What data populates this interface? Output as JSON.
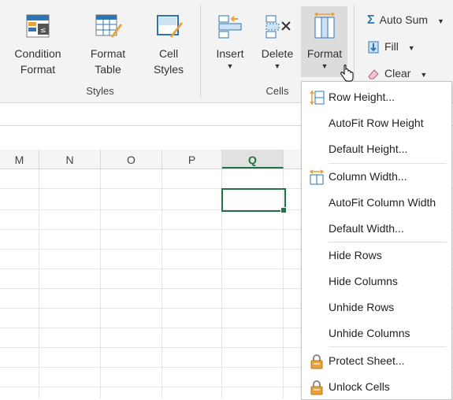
{
  "ribbon": {
    "styles_group": {
      "label": "Styles",
      "buttons": [
        {
          "line1": "Condition",
          "line2": "Format"
        },
        {
          "line1": "Format",
          "line2": "Table"
        },
        {
          "line1": "Cell",
          "line2": "Styles"
        }
      ]
    },
    "cells_group": {
      "label": "Cells",
      "buttons": [
        {
          "label": "Insert"
        },
        {
          "label": "Delete"
        },
        {
          "label": "Format"
        }
      ]
    },
    "editing_group": {
      "auto_sum": "Auto Sum",
      "fill": "Fill",
      "clear": "Clear"
    }
  },
  "columns": [
    "M",
    "N",
    "O",
    "P",
    "Q"
  ],
  "selected_column": "Q",
  "format_menu": {
    "items": [
      {
        "label": "Row Height...",
        "icon": "row-height-icon"
      },
      {
        "label": "AutoFit Row Height"
      },
      {
        "label": "Default Height..."
      },
      {
        "label": "Column Width...",
        "icon": "column-width-icon"
      },
      {
        "label": "AutoFit Column Width"
      },
      {
        "label": "Default Width..."
      },
      {
        "label": "Hide Rows"
      },
      {
        "label": "Hide Columns"
      },
      {
        "label": "Unhide Rows"
      },
      {
        "label": "Unhide Columns"
      },
      {
        "label": "Protect Sheet...",
        "icon": "lock-icon"
      },
      {
        "label": "Unlock Cells",
        "icon": "lock-icon"
      }
    ]
  },
  "colors": {
    "accent_green": "#217346",
    "icon_blue": "#2e75b6",
    "icon_orange": "#e8a23b"
  }
}
